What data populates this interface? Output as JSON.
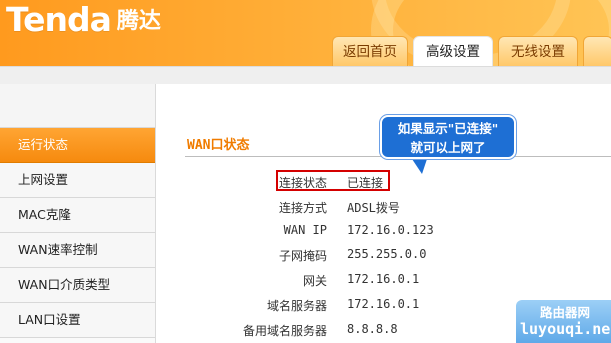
{
  "brand": {
    "logo_en": "Tenda",
    "logo_cn": "腾达"
  },
  "tabs": [
    {
      "label": "返回首页",
      "active": false
    },
    {
      "label": "高级设置",
      "active": true
    },
    {
      "label": "无线设置",
      "active": false
    },
    {
      "label": "",
      "active": false
    }
  ],
  "sidebar": {
    "items": [
      {
        "label": "运行状态",
        "active": true
      },
      {
        "label": "上网设置",
        "active": false
      },
      {
        "label": "MAC克隆",
        "active": false
      },
      {
        "label": "WAN速率控制",
        "active": false
      },
      {
        "label": "WAN口介质类型",
        "active": false
      },
      {
        "label": "LAN口设置",
        "active": false
      }
    ]
  },
  "main": {
    "section_title": "WAN口状态",
    "rows": [
      {
        "label": "连接状态",
        "value": "已连接"
      },
      {
        "label": "连接方式",
        "value": "ADSL拨号"
      },
      {
        "label": "WAN IP",
        "value": "172.16.0.123"
      },
      {
        "label": "子网掩码",
        "value": "255.255.0.0"
      },
      {
        "label": "网关",
        "value": "172.16.0.1"
      },
      {
        "label": "域名服务器",
        "value": "172.16.0.1"
      },
      {
        "label": "备用域名服务器",
        "value": "8.8.8.8"
      }
    ]
  },
  "callout": {
    "line1": "如果显示\"已连接\"",
    "line2": "就可以上网了"
  },
  "watermark": {
    "cn": "路由器网",
    "en": "luyouqi.net"
  },
  "colors": {
    "accent_orange": "#f68a0e",
    "status_red": "#d40000",
    "callout_blue": "#1e6fd4"
  }
}
